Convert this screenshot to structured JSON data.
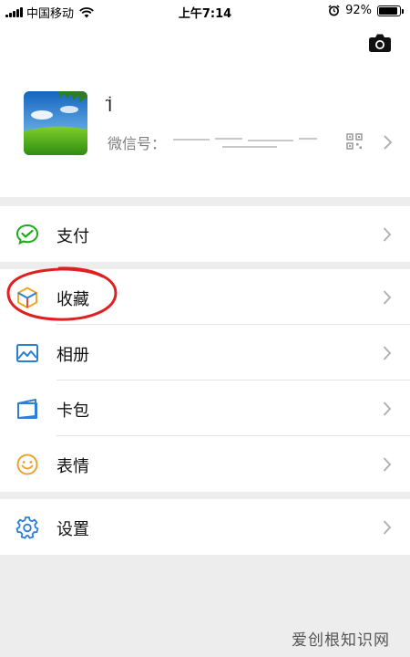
{
  "status_bar": {
    "carrier": "中国移动",
    "time": "上午7:14",
    "battery_percent_label": "92%",
    "battery_level": 0.92
  },
  "profile": {
    "nickname": "İ̃",
    "wechat_id_label": "微信号："
  },
  "menu": {
    "pay": {
      "label": "支付",
      "icon": "wechat-pay-icon"
    },
    "favorites": {
      "label": "收藏",
      "icon": "favorites-cube-icon"
    },
    "album": {
      "label": "相册",
      "icon": "album-picture-icon"
    },
    "cards": {
      "label": "卡包",
      "icon": "card-wallet-icon"
    },
    "stickers": {
      "label": "表情",
      "icon": "smiley-icon"
    },
    "settings": {
      "label": "设置",
      "icon": "gear-icon"
    }
  },
  "colors": {
    "pay_green": "#1aad19",
    "favorites_orange": "#f5a623",
    "blue_icon": "#2b7fd9",
    "stickers_orange": "#f0a030",
    "annotation_red": "#e02020"
  },
  "watermark": "爱创根知识网"
}
